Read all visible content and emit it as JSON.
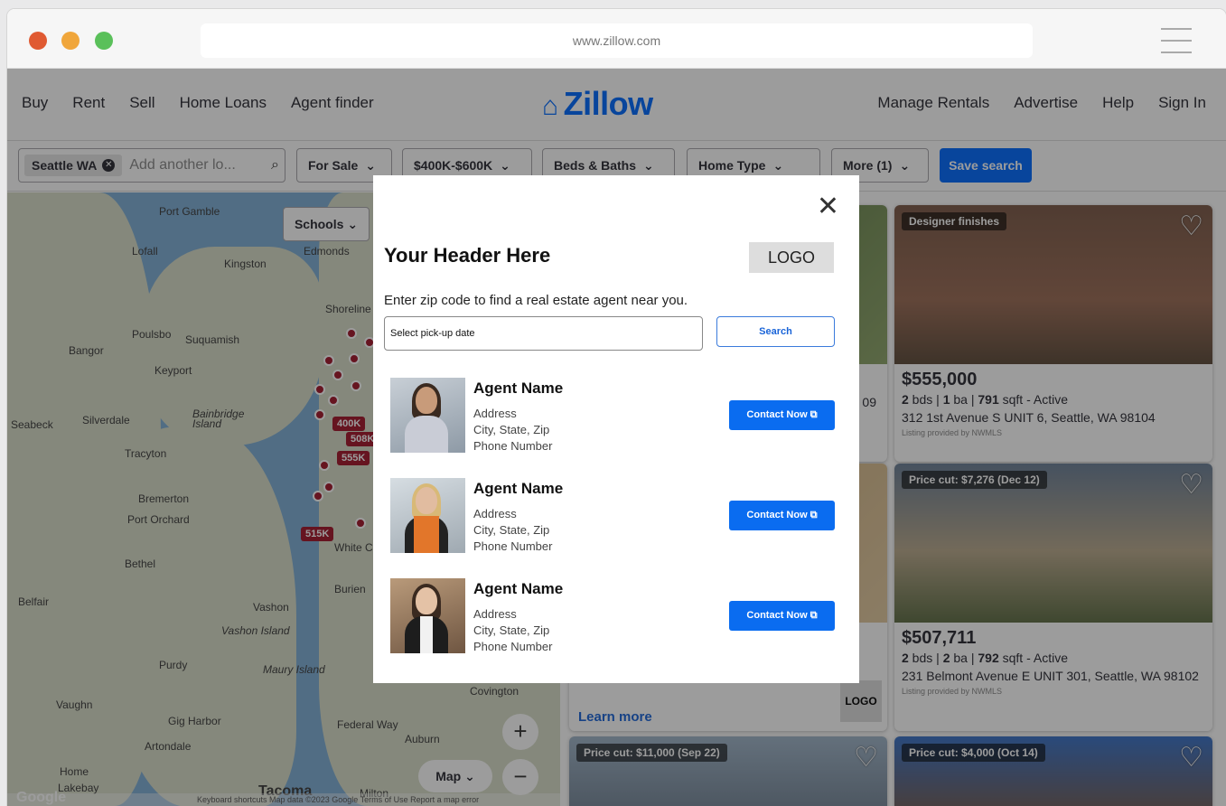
{
  "browser": {
    "url": "www.zillow.com"
  },
  "nav": {
    "left": [
      "Buy",
      "Rent",
      "Sell",
      "Home Loans",
      "Agent finder"
    ],
    "logo": "Zillow",
    "right": [
      "Manage Rentals",
      "Advertise",
      "Help",
      "Sign In"
    ]
  },
  "filters": {
    "location_chip": "Seattle WA",
    "location_placeholder": "Add another lo...",
    "for_sale": "For Sale",
    "price": "$400K-$600K",
    "beds_baths": "Beds & Baths",
    "home_type": "Home Type",
    "more": "More (1)",
    "save": "Save search"
  },
  "map": {
    "schools": "Schools",
    "map_type": "Map",
    "labels": [
      "Port Gamble",
      "Lofall",
      "Kingston",
      "Edmonds",
      "Shoreline",
      "Poulsbo",
      "Suquamish",
      "Bangor",
      "Keyport",
      "Silverdale",
      "Bainbridge Island",
      "Seabeck",
      "Tracyton",
      "Bremerton",
      "Port Orchard",
      "Bethel",
      "Belfair",
      "Vashon",
      "Vashon Island",
      "Burien",
      "Purdy",
      "Maury Island",
      "Vaughn",
      "Gig Harbor",
      "Federal Way",
      "Auburn",
      "Covington",
      "Artondale",
      "Home",
      "Lakebay",
      "Tacoma",
      "Milton",
      "White Center"
    ],
    "price_pins": [
      "400K",
      "508K",
      "555K",
      "515K"
    ],
    "footer": "Keyboard shortcuts   Map data ©2023 Google   Terms of Use   Report a map error",
    "google": "Google",
    "zoom_in": "+",
    "zoom_out": "−"
  },
  "listings": [
    {
      "badge": "Designer finishes",
      "price": "$555,000",
      "beds": "2",
      "baths": "1",
      "sqft": "791",
      "status": "Active",
      "address": "312 1st Avenue S UNIT 6, Seattle, WA 98104",
      "provider": "Listing provided by NWMLS"
    },
    {
      "badge": "Price cut: $7,276 (Dec 12)",
      "price": "$507,711",
      "beds": "2",
      "baths": "2",
      "sqft": "792",
      "status": "Active",
      "address": "231 Belmont Avenue E UNIT 301, Seattle, WA 98102",
      "provider": "Listing provided by NWMLS"
    },
    {
      "badge": "Price cut: $11,000 (Sep 22)"
    },
    {
      "badge": "Price cut: $4,000 (Oct 14)"
    }
  ],
  "partial": {
    "learn_more": "Learn more",
    "logo": "LOGO",
    "zip_fragment": "09"
  },
  "modal": {
    "title": "Your Header Here",
    "logo": "LOGO",
    "instructions": "Enter zip code to find a real estate agent near you.",
    "input_value": "Select pick-up date",
    "search_label": "Search",
    "agents": [
      {
        "name": "Agent Name",
        "address": "Address",
        "city": "City, State, Zip",
        "phone": "Phone Number",
        "contact": "Contact Now"
      },
      {
        "name": "Agent Name",
        "address": "Address",
        "city": "City, State, Zip",
        "phone": "Phone Number",
        "contact": "Contact Now"
      },
      {
        "name": "Agent Name",
        "address": "Address",
        "city": "City, State, Zip",
        "phone": "Phone Number",
        "contact": "Contact Now"
      }
    ]
  }
}
